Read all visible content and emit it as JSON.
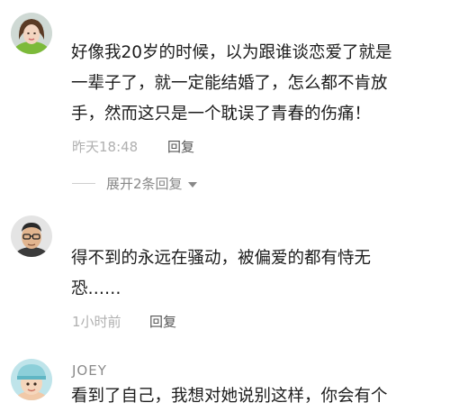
{
  "comments": [
    {
      "username": "",
      "text_lines": [
        "好像我20岁的时候，以为跟谁谈恋爱了就是",
        "一辈子了，就一定能结婚了，怎么都不肯放",
        "手，然而这只是一个耽误了青春的伤痛！"
      ],
      "time": "昨天18:48",
      "reply_label": "回复",
      "expand_label": "展开2条回复"
    },
    {
      "username": "",
      "text_lines": [
        "得不到的永远在骚动，被偏爱的都有恃无",
        "恐……"
      ],
      "time": "1小时前",
      "reply_label": "回复"
    },
    {
      "username": "JOEY",
      "text_lines": [
        "看到了自己，我想对她说别这样，你会有个"
      ]
    }
  ],
  "icons": {
    "expand": "chevron-down-icon"
  },
  "colors": {
    "text": "#1c1c1c",
    "meta": "#b0b0b0",
    "reply": "#555555",
    "username": "#8a8a8a"
  }
}
